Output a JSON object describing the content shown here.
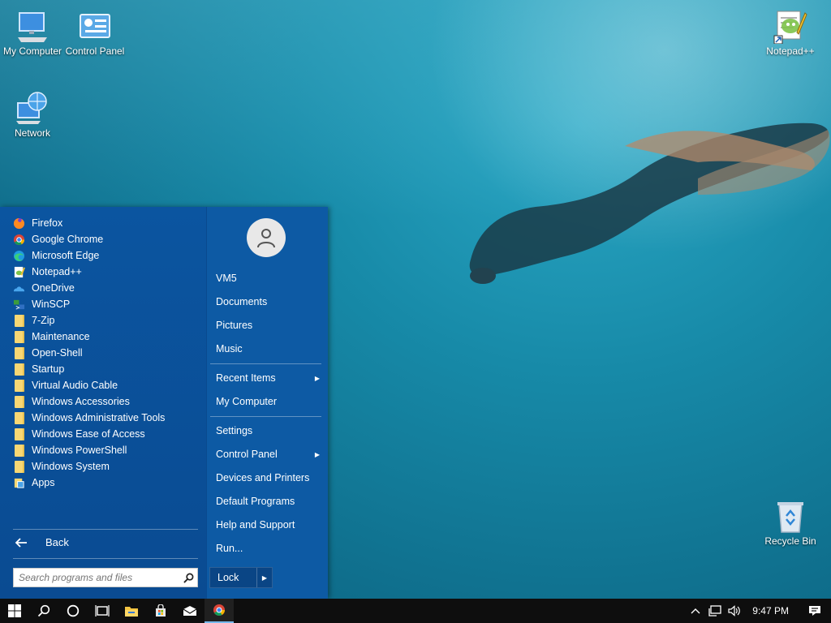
{
  "desktop": {
    "icons": [
      {
        "label": "My Computer",
        "icon": "computer-icon"
      },
      {
        "label": "Control Panel",
        "icon": "control-panel-icon"
      },
      {
        "label": "Network",
        "icon": "network-icon"
      },
      {
        "label": "Notepad++",
        "icon": "notepad-plus-plus-icon"
      },
      {
        "label": "Recycle Bin",
        "icon": "recycle-bin-icon"
      }
    ]
  },
  "start_menu": {
    "programs": [
      {
        "label": "Firefox",
        "icon": "firefox-icon"
      },
      {
        "label": "Google Chrome",
        "icon": "chrome-icon"
      },
      {
        "label": "Microsoft Edge",
        "icon": "edge-icon"
      },
      {
        "label": "Notepad++",
        "icon": "notepad-plus-plus-icon"
      },
      {
        "label": "OneDrive",
        "icon": "onedrive-icon"
      },
      {
        "label": "WinSCP",
        "icon": "winscp-icon"
      },
      {
        "label": "7-Zip",
        "icon": "folder-icon"
      },
      {
        "label": "Maintenance",
        "icon": "folder-icon"
      },
      {
        "label": "Open-Shell",
        "icon": "folder-icon"
      },
      {
        "label": "Startup",
        "icon": "folder-icon"
      },
      {
        "label": "Virtual Audio Cable",
        "icon": "folder-icon"
      },
      {
        "label": "Windows Accessories",
        "icon": "folder-icon"
      },
      {
        "label": "Windows Administrative Tools",
        "icon": "folder-icon"
      },
      {
        "label": "Windows Ease of Access",
        "icon": "folder-icon"
      },
      {
        "label": "Windows PowerShell",
        "icon": "folder-icon"
      },
      {
        "label": "Windows System",
        "icon": "folder-icon"
      },
      {
        "label": "Apps",
        "icon": "apps-icon"
      }
    ],
    "back_label": "Back",
    "search_placeholder": "Search programs and files",
    "right_items": [
      {
        "label": "VM5",
        "arrow": false
      },
      {
        "label": "Documents",
        "arrow": false
      },
      {
        "label": "Pictures",
        "arrow": false
      },
      {
        "label": "Music",
        "arrow": false
      },
      {
        "label": "Recent Items",
        "arrow": true
      },
      {
        "label": "My Computer",
        "arrow": false
      },
      {
        "label": "Settings",
        "arrow": false
      },
      {
        "label": "Control Panel",
        "arrow": true
      },
      {
        "label": "Devices and Printers",
        "arrow": false
      },
      {
        "label": "Default Programs",
        "arrow": false
      },
      {
        "label": "Help and Support",
        "arrow": false
      },
      {
        "label": "Run...",
        "arrow": false
      }
    ],
    "lock_label": "Lock"
  },
  "taskbar": {
    "clock": "9:47 PM"
  },
  "colors": {
    "start_menu_bg": "#0a4b92",
    "taskbar_bg": "#0e0e0e",
    "folder": "#f7d774"
  }
}
